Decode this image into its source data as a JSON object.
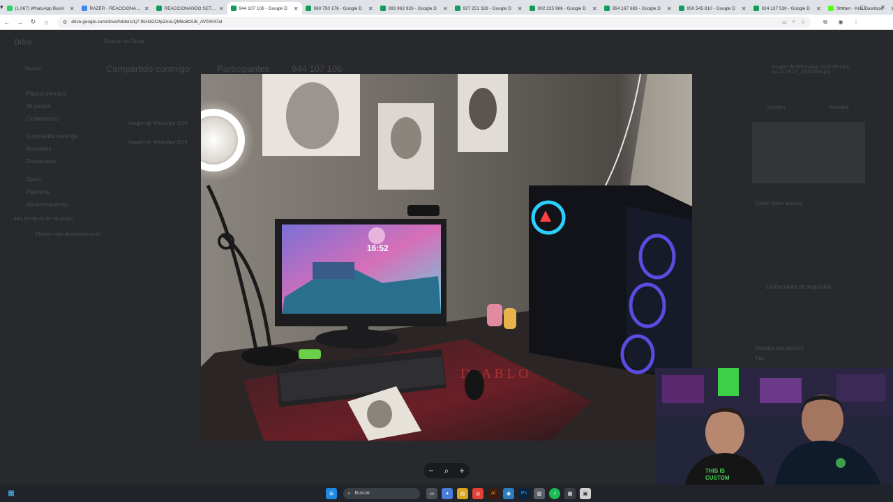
{
  "browser": {
    "tabs": [
      {
        "label": "(1,067) WhatsApp Busin",
        "color": "#25d366"
      },
      {
        "label": "RAZER - REACCIONANDO",
        "color": "#4285f4"
      },
      {
        "label": "REACCIONANDO SETUPS",
        "color": "#0f9d58"
      },
      {
        "label": "944 107 106 - Google D",
        "color": "#0f9d58",
        "active": true
      },
      {
        "label": "960 750 178 - Google D",
        "color": "#0f9d58"
      },
      {
        "label": "993 963 926 - Google D",
        "color": "#0f9d58"
      },
      {
        "label": "927 251 328 - Google D",
        "color": "#0f9d58"
      },
      {
        "label": "902 225 966 - Google D",
        "color": "#0f9d58"
      },
      {
        "label": "954 167 683 - Google D",
        "color": "#0f9d58"
      },
      {
        "label": "950 545 810 - Google D",
        "color": "#0f9d58"
      },
      {
        "label": "924 137 530 - Google D",
        "color": "#0f9d58"
      },
      {
        "label": "Stream - Kick Dashboa",
        "color": "#53fc18"
      }
    ],
    "url": "drive.google.com/drive/folders/1j7-9kH1GC4pZnoLQM6o8OU6_AV0XHt7al"
  },
  "drive": {
    "app_name": "Drive",
    "search_placeholder": "Buscar en Drive",
    "new_button": "Nuevo",
    "breadcrumb": [
      "Compartido conmigo",
      "Participantes",
      "944 107 106"
    ],
    "sidebar": [
      "Página principal",
      "Mi unidad",
      "Ordenadores",
      "Compartido conmigo",
      "Recientes",
      "Destacados",
      "Spam",
      "Papelera",
      "Almacenamiento"
    ],
    "storage": "445,28 GB de 30 TB usado",
    "storage_button": "Obtener más almacenamiento",
    "files": [
      "Imagen de WhatsApp 2024",
      "Imagen de WhatsApp 2024"
    ],
    "details_title": "Imagen de WhatsApp 2024-09-29 a las 12.29.07_35052b46.jpg",
    "details_tabs": [
      "Detalles",
      "Actividad"
    ],
    "access_title": "Quién tiene acceso",
    "security": "Limitaciones de seguridad",
    "file_details": "Detalles del archivo",
    "type": "Tipo"
  },
  "viewer": {
    "monitor_clock": "16:52",
    "zoom_out": "−",
    "zoom_icon": "magnifier-icon",
    "zoom_in": "+"
  },
  "taskbar": {
    "search_label": "Buscar"
  },
  "webcam": {
    "shirt_text_1": "THIS IS",
    "shirt_text_2": "CUSTOM"
  }
}
